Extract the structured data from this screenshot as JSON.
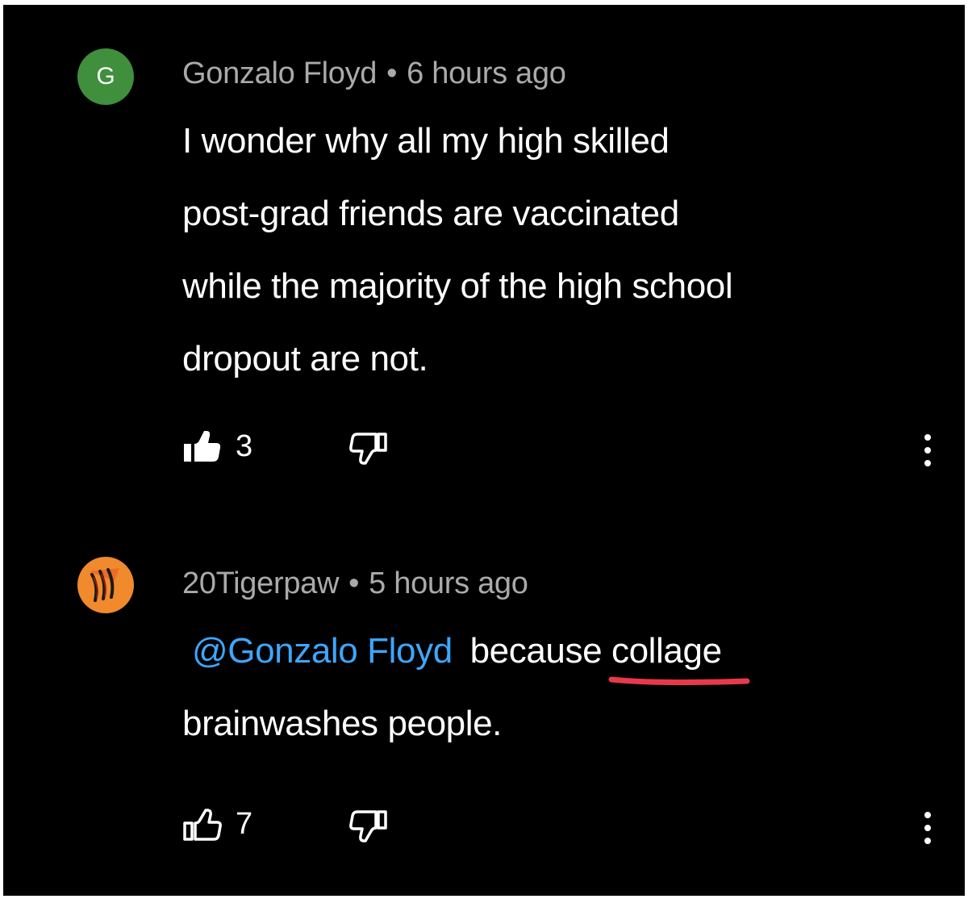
{
  "comments": [
    {
      "avatar": {
        "type": "letter",
        "letter": "G",
        "color": "#3f8f3c"
      },
      "author": "Gonzalo Floyd",
      "separator": "•",
      "time": "6 hours ago",
      "lines": [
        "I wonder why all my high skilled",
        "post-grad friends are vaccinated",
        "while the majority of the high school",
        "dropout are not."
      ],
      "likes": "3",
      "liked": true,
      "like_icon": "thumbs-up-icon-filled",
      "dislike_icon": "thumbs-down-icon",
      "more_icon": "more-vertical-icon"
    },
    {
      "avatar": {
        "type": "image",
        "icon": "tiger-claw-icon",
        "color": "#f08a2c"
      },
      "author": "20Tigerpaw",
      "separator": "•",
      "time": "5 hours ago",
      "mention": "@Gonzalo Floyd",
      "text_after_mention": "because",
      "underlined_word": "collage",
      "line2": "brainwashes people.",
      "likes": "7",
      "liked": false,
      "like_icon": "thumbs-up-icon-outline",
      "dislike_icon": "thumbs-down-icon",
      "more_icon": "more-vertical-icon",
      "annotation_color": "#e8394a"
    }
  ]
}
